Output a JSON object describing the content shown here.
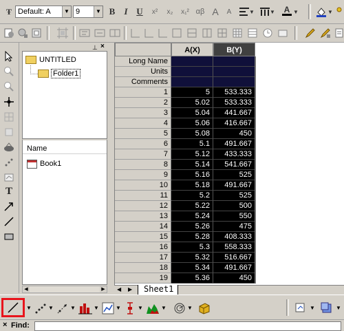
{
  "toolbar_format": {
    "font_name": "Default: A",
    "font_size": "9",
    "bold": "B",
    "italic": "I",
    "underline": "U",
    "superscript": "x²",
    "subscript": "x₂",
    "super_sub": "x₁²",
    "greek": "αβ",
    "font_bigger": "A",
    "font_smaller": "A",
    "text_color": "A"
  },
  "project": {
    "root": "UNTITLED",
    "folder": "Folder1",
    "name_header": "Name",
    "book": "Book1"
  },
  "worksheet": {
    "columns": [
      "A(X)",
      "B(Y)"
    ],
    "label_rows": [
      "Long Name",
      "Units",
      "Comments"
    ],
    "rows": [
      {
        "n": "1",
        "a": "5",
        "b": "533.333"
      },
      {
        "n": "2",
        "a": "5.02",
        "b": "533.333"
      },
      {
        "n": "3",
        "a": "5.04",
        "b": "441.667"
      },
      {
        "n": "4",
        "a": "5.06",
        "b": "416.667"
      },
      {
        "n": "5",
        "a": "5.08",
        "b": "450"
      },
      {
        "n": "6",
        "a": "5.1",
        "b": "491.667"
      },
      {
        "n": "7",
        "a": "5.12",
        "b": "433.333"
      },
      {
        "n": "8",
        "a": "5.14",
        "b": "541.667"
      },
      {
        "n": "9",
        "a": "5.16",
        "b": "525"
      },
      {
        "n": "10",
        "a": "5.18",
        "b": "491.667"
      },
      {
        "n": "11",
        "a": "5.2",
        "b": "525"
      },
      {
        "n": "12",
        "a": "5.22",
        "b": "500"
      },
      {
        "n": "13",
        "a": "5.24",
        "b": "550"
      },
      {
        "n": "14",
        "a": "5.26",
        "b": "475"
      },
      {
        "n": "15",
        "a": "5.28",
        "b": "408.333"
      },
      {
        "n": "16",
        "a": "5.3",
        "b": "558.333"
      },
      {
        "n": "17",
        "a": "5.32",
        "b": "516.667"
      },
      {
        "n": "18",
        "a": "5.34",
        "b": "491.667"
      },
      {
        "n": "19",
        "a": "5.36",
        "b": "450"
      }
    ],
    "sheet_tab": "Sheet1"
  },
  "find": {
    "label": "Find:",
    "close": "×"
  },
  "colors": {
    "highlight": "#e8141c",
    "selection": "#000000",
    "label_rows_bg": "#10103a"
  }
}
